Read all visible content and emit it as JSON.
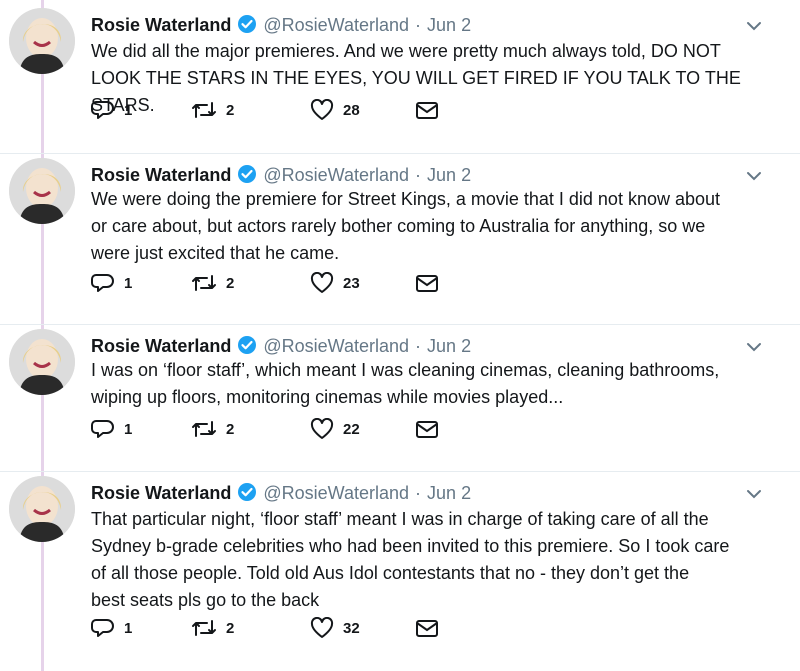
{
  "tweets": [
    {
      "name": "Rosie Waterland",
      "handle": "@RosieWaterland",
      "dot": "·",
      "time": "Jun 2",
      "lines": [
        "We did all the major premieres. And we were pretty much always told, DO NOT",
        "LOOK THE STARS IN THE EYES, YOU WILL GET FIRED IF YOU TALK TO THE STARS."
      ],
      "replies": "1",
      "retweets": "2",
      "likes": "28"
    },
    {
      "name": "Rosie Waterland",
      "handle": "@RosieWaterland",
      "dot": "·",
      "time": "Jun 2",
      "lines": [
        "We were doing the premiere for Street Kings, a movie that I did not know about",
        "or care about, but actors rarely bother coming to Australia for anything, so we",
        "were just excited that he came."
      ],
      "replies": "1",
      "retweets": "2",
      "likes": "23"
    },
    {
      "name": "Rosie Waterland",
      "handle": "@RosieWaterland",
      "dot": "·",
      "time": "Jun 2",
      "lines": [
        "I was on ‘floor staff’, which meant I was cleaning cinemas, cleaning bathrooms,",
        "wiping up floors, monitoring cinemas while movies played..."
      ],
      "replies": "1",
      "retweets": "2",
      "likes": "22"
    },
    {
      "name": "Rosie Waterland",
      "handle": "@RosieWaterland",
      "dot": "·",
      "time": "Jun 2",
      "lines": [
        "That particular night, ‘floor staff’ meant I was in charge of taking care of all the",
        "Sydney b-grade celebrities who had been invited to this premiere. So I took care",
        "of all those people. Told old Aus Idol contestants that no - they don’t get the",
        "best seats pls go to the back"
      ],
      "replies": "1",
      "retweets": "2",
      "likes": "32"
    }
  ],
  "colors": {
    "verified": "#1da1f2",
    "muted": "#657786",
    "text": "#14171a",
    "thread_line": "#e6d3ea"
  },
  "icons": {
    "reply": "reply-icon",
    "retweet": "retweet-icon",
    "like": "heart-icon",
    "dm": "envelope-icon",
    "menu": "chevron-down-icon",
    "verified": "verified-badge-icon"
  }
}
